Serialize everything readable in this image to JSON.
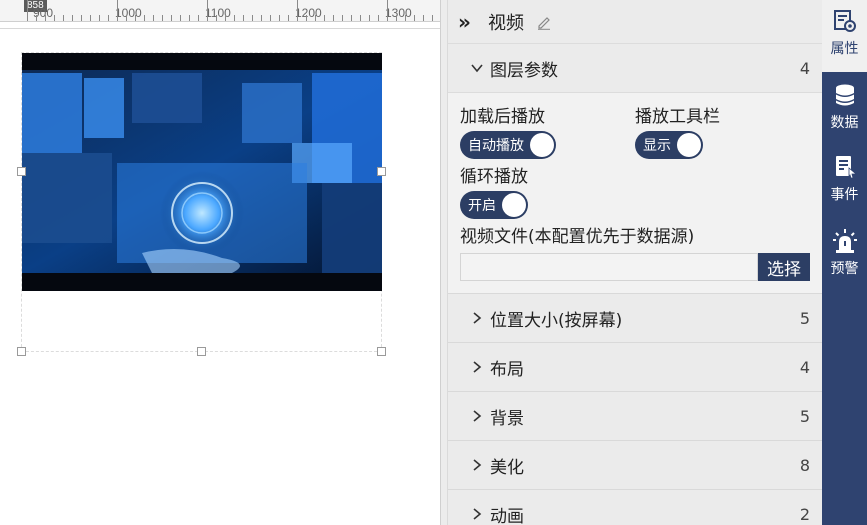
{
  "ruler": {
    "position_badge": "858",
    "labels": [
      "900",
      "1000",
      "1100",
      "1200",
      "1300"
    ]
  },
  "panel": {
    "title": "视频",
    "collapse_glyph": "»",
    "sections": [
      {
        "name": "图层参数",
        "count": "4",
        "expanded": true,
        "fields": {
          "autoplay_label": "加载后播放",
          "autoplay_toggle": "自动播放",
          "toolbar_label": "播放工具栏",
          "toolbar_toggle": "显示",
          "loop_label": "循环播放",
          "loop_toggle": "开启",
          "file_label": "视频文件(本配置优先于数据源)",
          "file_value": "",
          "file_button": "选择"
        }
      },
      {
        "name": "位置大小(按屏幕)",
        "count": "5",
        "expanded": false
      },
      {
        "name": "布局",
        "count": "4",
        "expanded": false
      },
      {
        "name": "背景",
        "count": "5",
        "expanded": false
      },
      {
        "name": "美化",
        "count": "8",
        "expanded": false
      },
      {
        "name": "动画",
        "count": "2",
        "expanded": false
      }
    ]
  },
  "tabs": [
    {
      "label": "属性",
      "icon": "properties-icon",
      "active": true
    },
    {
      "label": "数据",
      "icon": "database-icon",
      "active": false
    },
    {
      "label": "事件",
      "icon": "event-icon",
      "active": false
    },
    {
      "label": "预警",
      "icon": "alarm-icon",
      "active": false
    }
  ],
  "colors": {
    "accent": "#2c3e64",
    "tabbar": "#2f4370",
    "panel_bg": "#ebebeb"
  }
}
